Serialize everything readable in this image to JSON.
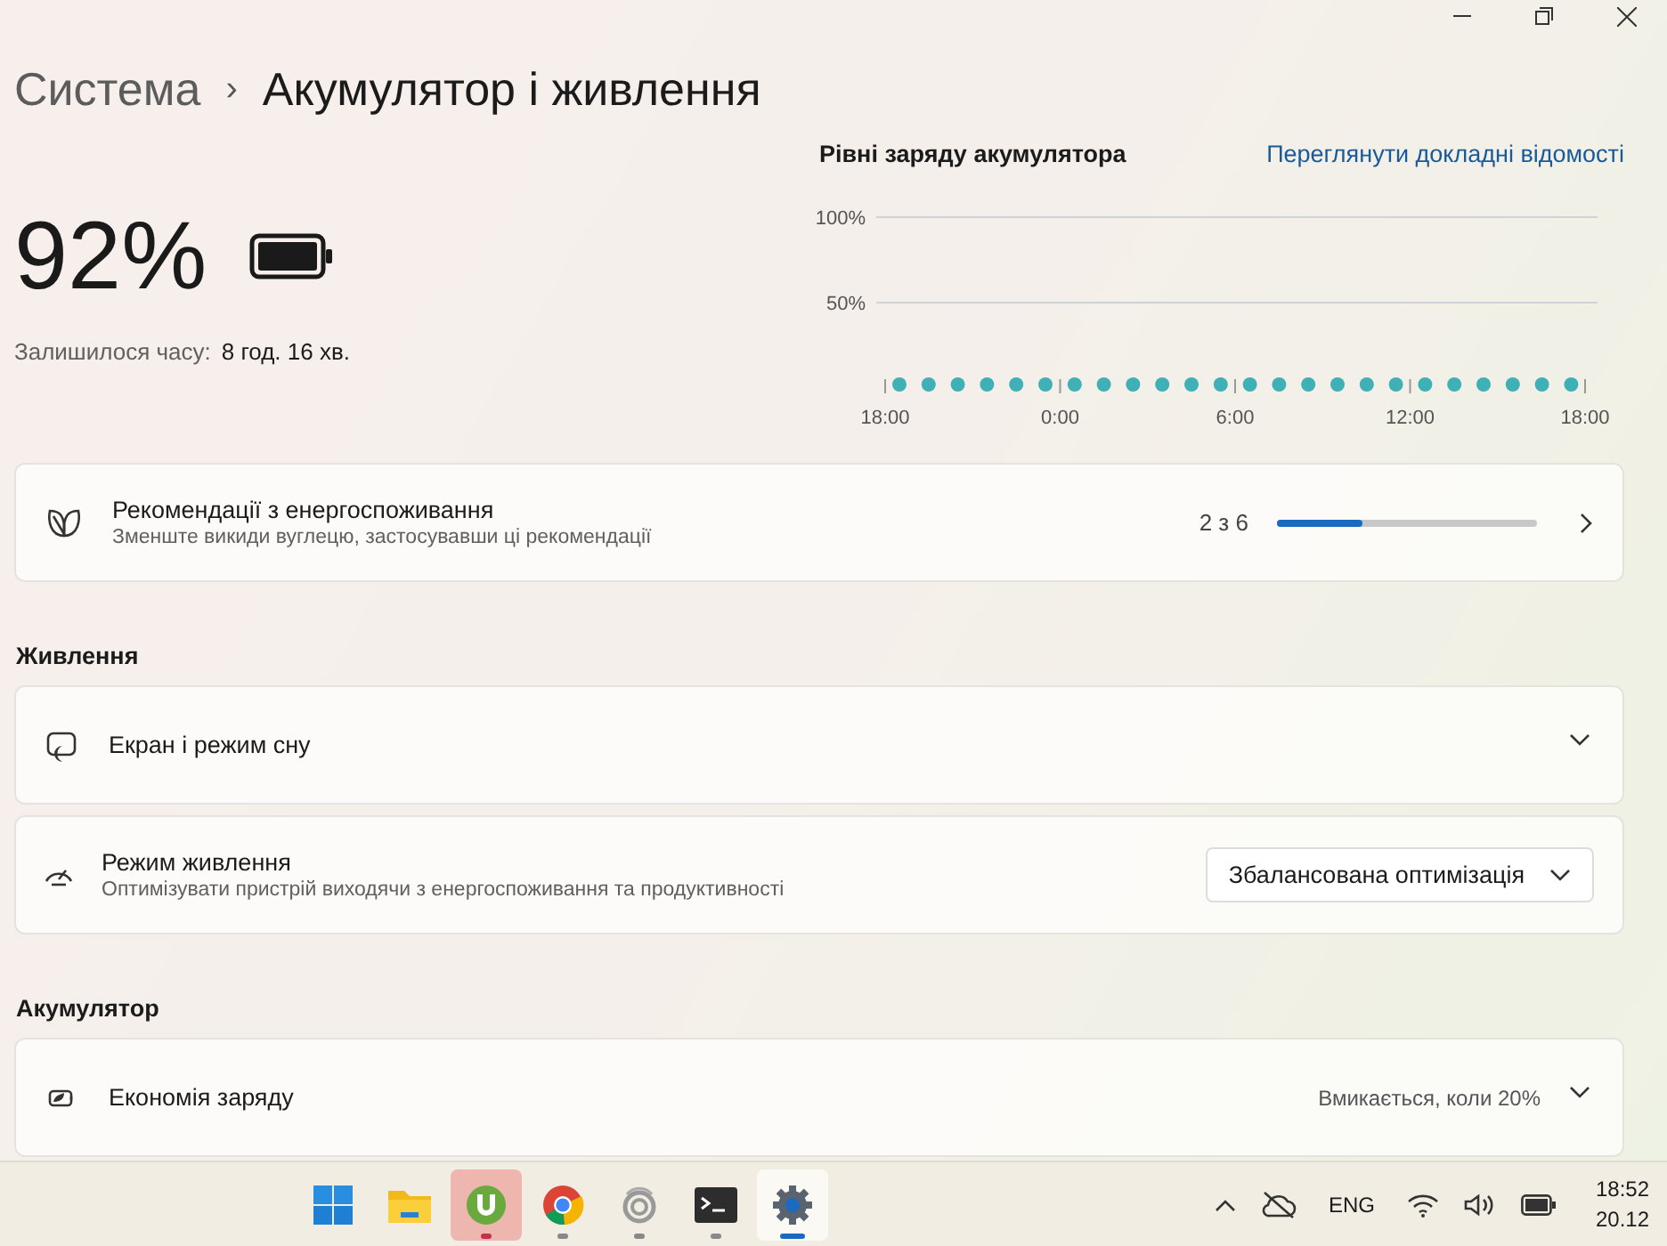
{
  "breadcrumb": {
    "parent": "Система",
    "separator": "›",
    "current": "Акумулятор і живлення"
  },
  "battery": {
    "percent": "92%",
    "remaining_label": "Залишилося часу:",
    "remaining_value": "8 год. 16 хв."
  },
  "usage": {
    "title": "Рівні заряду акумулятора",
    "link": "Переглянути докладні відомості",
    "y_labels": [
      "100%",
      "50%"
    ],
    "x_labels": [
      "18:00",
      "0:00",
      "6:00",
      "12:00",
      "18:00"
    ]
  },
  "recommendations": {
    "title": "Рекомендації з енергоспоживання",
    "subtitle": "Зменште викиди вуглецю, застосувавши ці рекомендації",
    "count": "2 з 6",
    "level": 0.33
  },
  "sections": [
    {
      "title": "Живлення",
      "rows": [
        {
          "kind": "expander",
          "title": "Екран і режим сну",
          "expanded": false
        },
        {
          "kind": "dropdown",
          "title": "Режим живлення",
          "subtitle": "Оптимізувати пристрій виходячи з енергоспоживання та продуктивності",
          "value": "Збалансована оптимізація"
        }
      ]
    },
    {
      "title": "Акумулятор",
      "rows": [
        {
          "kind": "expander",
          "title": "Економія заряду",
          "status": "Вмикається, коли 20%",
          "expanded": false
        }
      ]
    }
  ],
  "taskbar": {
    "apps": [
      {
        "kind": "start",
        "running": false,
        "attention": false,
        "selected": false
      },
      {
        "kind": "folder",
        "running": false,
        "attention": false,
        "selected": false
      },
      {
        "kind": "torrent",
        "running": true,
        "attention": true,
        "selected": false
      },
      {
        "kind": "browser",
        "running": true,
        "attention": false,
        "selected": false
      },
      {
        "kind": "ring",
        "running": true,
        "attention": false,
        "selected": false
      },
      {
        "kind": "terminal",
        "running": true,
        "attention": false,
        "selected": false
      },
      {
        "kind": "settings",
        "running": true,
        "attention": false,
        "selected": true
      }
    ],
    "language": "ENG",
    "time": "18:52",
    "date": "20.12"
  }
}
